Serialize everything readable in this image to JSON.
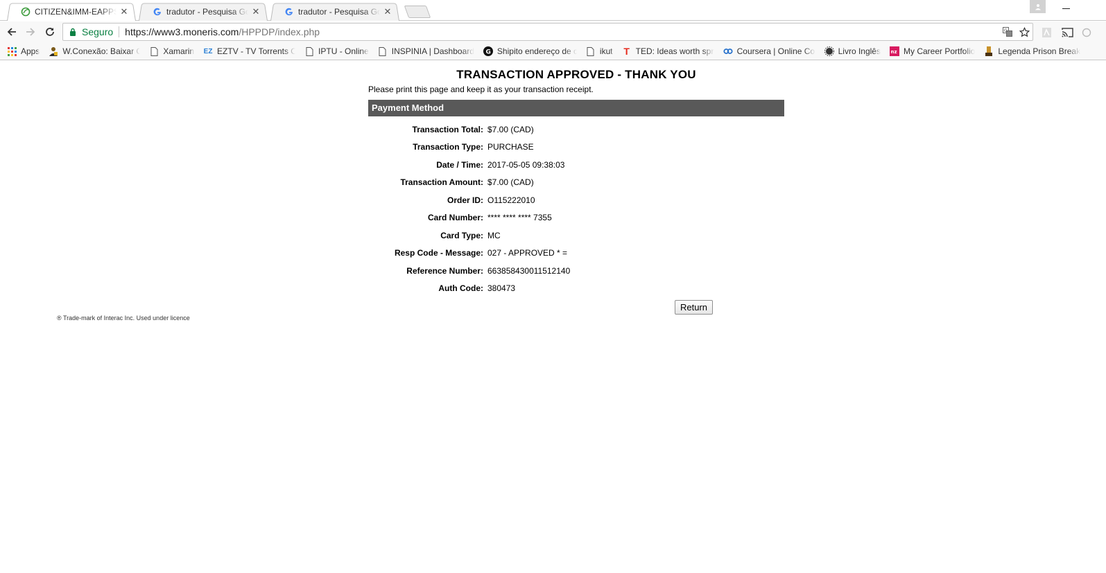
{
  "tabs": [
    {
      "title": "CITIZEN&IMM-EAPPS EN",
      "active": true,
      "icon": "citizenship-leaf-icon"
    },
    {
      "title": "tradutor - Pesquisa Goog",
      "active": false,
      "icon": "google-g-icon"
    },
    {
      "title": "tradutor - Pesquisa Goog",
      "active": false,
      "icon": "google-g-icon"
    }
  ],
  "omnibox": {
    "secure_label": "Seguro",
    "url_host": "https://www3.moneris.com",
    "url_path": "/HPPDP/index.php"
  },
  "bookmarks": [
    {
      "label": "Apps",
      "icon": "apps-grid-icon"
    },
    {
      "label": "W.Conexão: Baixar Ca",
      "icon": "user-download-icon"
    },
    {
      "label": "Xamarin",
      "icon": "page-icon"
    },
    {
      "label": "EZTV - TV Torrents Or",
      "icon": "eztv-icon"
    },
    {
      "label": "IPTU - Online",
      "icon": "page-icon"
    },
    {
      "label": "INSPINIA | Dashboard",
      "icon": "page-icon"
    },
    {
      "label": "Shipito endereço de c",
      "icon": "shipito-icon"
    },
    {
      "label": "ikut",
      "icon": "page-icon"
    },
    {
      "label": "TED: Ideas worth spre",
      "icon": "ted-icon"
    },
    {
      "label": "Coursera | Online Cou",
      "icon": "coursera-icon"
    },
    {
      "label": "Livro Inglês",
      "icon": "gear-badge-icon"
    },
    {
      "label": "My Career Portfolio",
      "icon": "portfolio-icon"
    },
    {
      "label": "Legenda Prison Break",
      "icon": "legenda-icon"
    }
  ],
  "receipt": {
    "heading": "TRANSACTION APPROVED - THANK YOU",
    "instructions": "Please print this page and keep it as your transaction receipt.",
    "section_title": "Payment Method",
    "fields": [
      {
        "label": "Transaction Total:",
        "value": "$7.00 (CAD)"
      },
      {
        "label": "Transaction Type:",
        "value": "PURCHASE"
      },
      {
        "label": "Date / Time:",
        "value": "2017-05-05 09:38:03"
      },
      {
        "label": "Transaction Amount:",
        "value": "$7.00 (CAD)"
      },
      {
        "label": "Order ID:",
        "value": "O115222010"
      },
      {
        "label": "Card Number:",
        "value": "**** **** **** 7355"
      },
      {
        "label": "Card Type:",
        "value": "MC"
      },
      {
        "label": "Resp Code - Message:",
        "value": "027 - APPROVED * ="
      },
      {
        "label": "Reference Number:",
        "value": "663858430011512140"
      },
      {
        "label": "Auth Code:",
        "value": "380473"
      }
    ],
    "return_label": "Return"
  },
  "footer_note": "® Trade-mark of Interac Inc. Used under licence",
  "colors": {
    "section_header_bg": "#595959",
    "secure_green": "#0b8043"
  }
}
